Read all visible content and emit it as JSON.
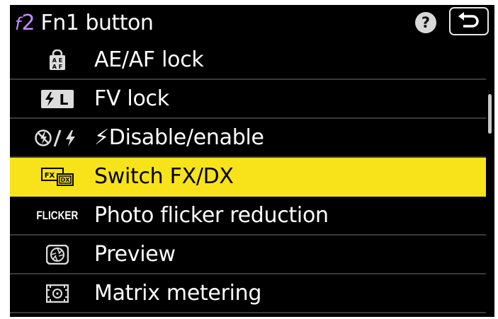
{
  "header": {
    "menu_code_prefix": "f",
    "menu_code_number": "2",
    "title": "Fn1 button",
    "help_symbol": "?",
    "back_icon": "return-arrow-icon"
  },
  "items": [
    {
      "icon": "ae-af-lock-icon",
      "label": "AE/AF lock"
    },
    {
      "icon": "fv-lock-icon",
      "label": "FV lock"
    },
    {
      "icon": "flash-disable-enable-icon",
      "label": "⚡Disable/enable"
    },
    {
      "icon": "fx-dx-icon",
      "label": "Switch FX/DX",
      "selected": true
    },
    {
      "icon": "flicker-icon",
      "icon_text": "FLICKER",
      "label": "Photo flicker reduction"
    },
    {
      "icon": "preview-aperture-icon",
      "label": "Preview"
    },
    {
      "icon": "matrix-metering-icon",
      "label": "Matrix metering"
    }
  ],
  "colors": {
    "highlight": "#f8e21a",
    "menu_code": "#c58cff",
    "background": "#000000"
  }
}
